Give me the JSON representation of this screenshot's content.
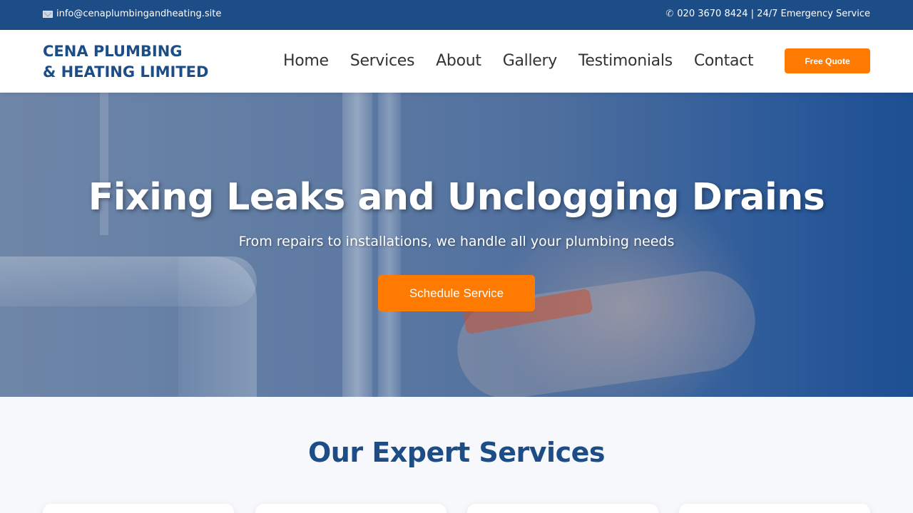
{
  "topbar": {
    "email": "info@cenaplumbingandheating.site",
    "email_icon": "mail-icon",
    "phone_text": "020 3670 8424 | 24/7 Emergency Service",
    "phone_icon": "phone-icon"
  },
  "brand": {
    "line1": "CENA PLUMBING",
    "line2": "& HEATING LIMITED"
  },
  "nav": {
    "items": [
      "Home",
      "Services",
      "About",
      "Gallery",
      "Testimonials",
      "Contact"
    ],
    "cta": "Free Quote"
  },
  "hero": {
    "title": "Fixing Leaks and Unclogging Drains",
    "subtitle": "From repairs to installations, we handle all your plumbing needs",
    "button": "Schedule Service"
  },
  "services": {
    "title": "Our Expert Services"
  },
  "colors": {
    "primary": "#1c4d86",
    "accent": "#ff7a00"
  }
}
